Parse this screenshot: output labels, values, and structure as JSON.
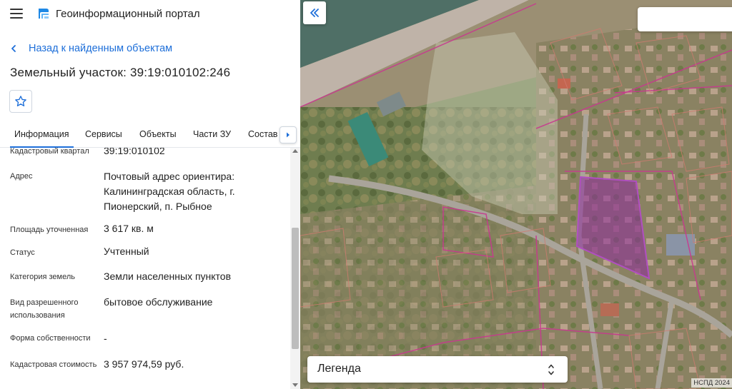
{
  "header": {
    "title": "Геоинформационный портал",
    "menu_icon": "menu-icon",
    "logo_icon": "portal-logo-icon"
  },
  "back_link": {
    "label": "Назад к найденным объектам"
  },
  "object": {
    "title": "Земельный участок: 39:19:010102:246"
  },
  "tabs": [
    {
      "label": "Информация",
      "active": true
    },
    {
      "label": "Сервисы",
      "active": false
    },
    {
      "label": "Объекты",
      "active": false
    },
    {
      "label": "Части ЗУ",
      "active": false
    },
    {
      "label": "Состав",
      "active": false
    }
  ],
  "info_rows": [
    {
      "label": "Кадастровый квартал",
      "value": "39:19:010102"
    },
    {
      "label": "Адрес",
      "value": "Почтовый адрес ориентира: Калининградская область, г. Пионерский, п. Рыбное"
    },
    {
      "label": "Площадь уточненная",
      "value": "3 617 кв. м"
    },
    {
      "label": "Статус",
      "value": "Учтенный"
    },
    {
      "label": "Категория земель",
      "value": "Земли населенных пунктов"
    },
    {
      "label": "Вид разрешенного использования",
      "value": "бытовое обслуживание"
    },
    {
      "label": "Форма собственности",
      "value": "-"
    },
    {
      "label": "Кадастровая стоимость",
      "value": "3 957 974,59 руб."
    }
  ],
  "map": {
    "search_placeholder": "",
    "legend_label": "Легенда",
    "attribution": "НСПД 2024",
    "parcel_highlight_color": "#8e2a9c",
    "boundary_color": "#c8388f"
  },
  "colors": {
    "accent": "#1e6fd9"
  }
}
